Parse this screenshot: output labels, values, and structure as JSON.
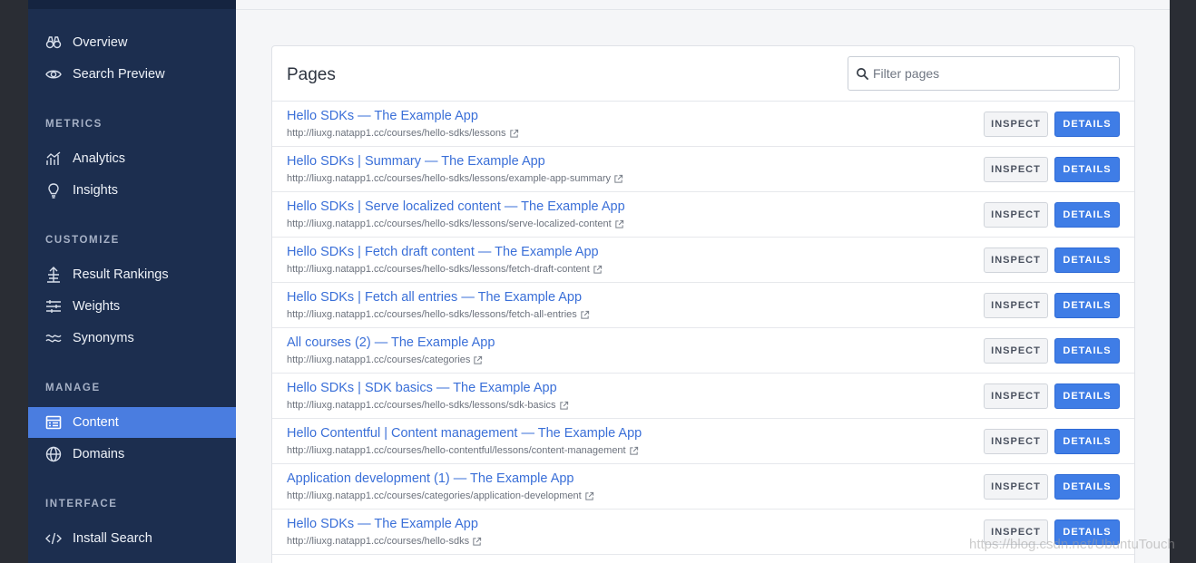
{
  "sidebar": {
    "top_items": [
      {
        "label": "Overview",
        "icon": "binoculars-icon"
      },
      {
        "label": "Search Preview",
        "icon": "eye-icon"
      }
    ],
    "sections": [
      {
        "title": "METRICS",
        "items": [
          {
            "label": "Analytics",
            "icon": "chart-icon"
          },
          {
            "label": "Insights",
            "icon": "lightbulb-icon"
          }
        ]
      },
      {
        "title": "CUSTOMIZE",
        "items": [
          {
            "label": "Result Rankings",
            "icon": "rankings-icon"
          },
          {
            "label": "Weights",
            "icon": "sliders-icon"
          },
          {
            "label": "Synonyms",
            "icon": "wave-icon"
          }
        ]
      },
      {
        "title": "MANAGE",
        "items": [
          {
            "label": "Content",
            "icon": "content-icon",
            "active": true
          },
          {
            "label": "Domains",
            "icon": "globe-icon"
          }
        ]
      },
      {
        "title": "INTERFACE",
        "items": [
          {
            "label": "Install Search",
            "icon": "code-icon"
          }
        ]
      }
    ]
  },
  "pages": {
    "title": "Pages",
    "filter_placeholder": "Filter pages",
    "inspect_label": "INSPECT",
    "details_label": "DETAILS",
    "rows": [
      {
        "title": "Hello SDKs — The Example App",
        "url": "http://liuxg.natapp1.cc/courses/hello-sdks/lessons"
      },
      {
        "title": "Hello SDKs | Summary — The Example App",
        "url": "http://liuxg.natapp1.cc/courses/hello-sdks/lessons/example-app-summary"
      },
      {
        "title": "Hello SDKs | Serve localized content — The Example App",
        "url": "http://liuxg.natapp1.cc/courses/hello-sdks/lessons/serve-localized-content"
      },
      {
        "title": "Hello SDKs | Fetch draft content — The Example App",
        "url": "http://liuxg.natapp1.cc/courses/hello-sdks/lessons/fetch-draft-content"
      },
      {
        "title": "Hello SDKs | Fetch all entries — The Example App",
        "url": "http://liuxg.natapp1.cc/courses/hello-sdks/lessons/fetch-all-entries"
      },
      {
        "title": "All courses (2) — The Example App",
        "url": "http://liuxg.natapp1.cc/courses/categories"
      },
      {
        "title": "Hello SDKs | SDK basics — The Example App",
        "url": "http://liuxg.natapp1.cc/courses/hello-sdks/lessons/sdk-basics"
      },
      {
        "title": "Hello Contentful | Content management — The Example App",
        "url": "http://liuxg.natapp1.cc/courses/hello-contentful/lessons/content-management"
      },
      {
        "title": "Application development (1) — The Example App",
        "url": "http://liuxg.natapp1.cc/courses/categories/application-development"
      },
      {
        "title": "Hello SDKs — The Example App",
        "url": "http://liuxg.natapp1.cc/courses/hello-sdks"
      }
    ]
  },
  "watermark": "https://blog.csdn.net/UbuntuTouch",
  "colors": {
    "sidebar_bg": "#1c2e4f",
    "active_item": "#4a7de0",
    "link": "#3a6fd8",
    "details_button": "#3f7de6"
  }
}
